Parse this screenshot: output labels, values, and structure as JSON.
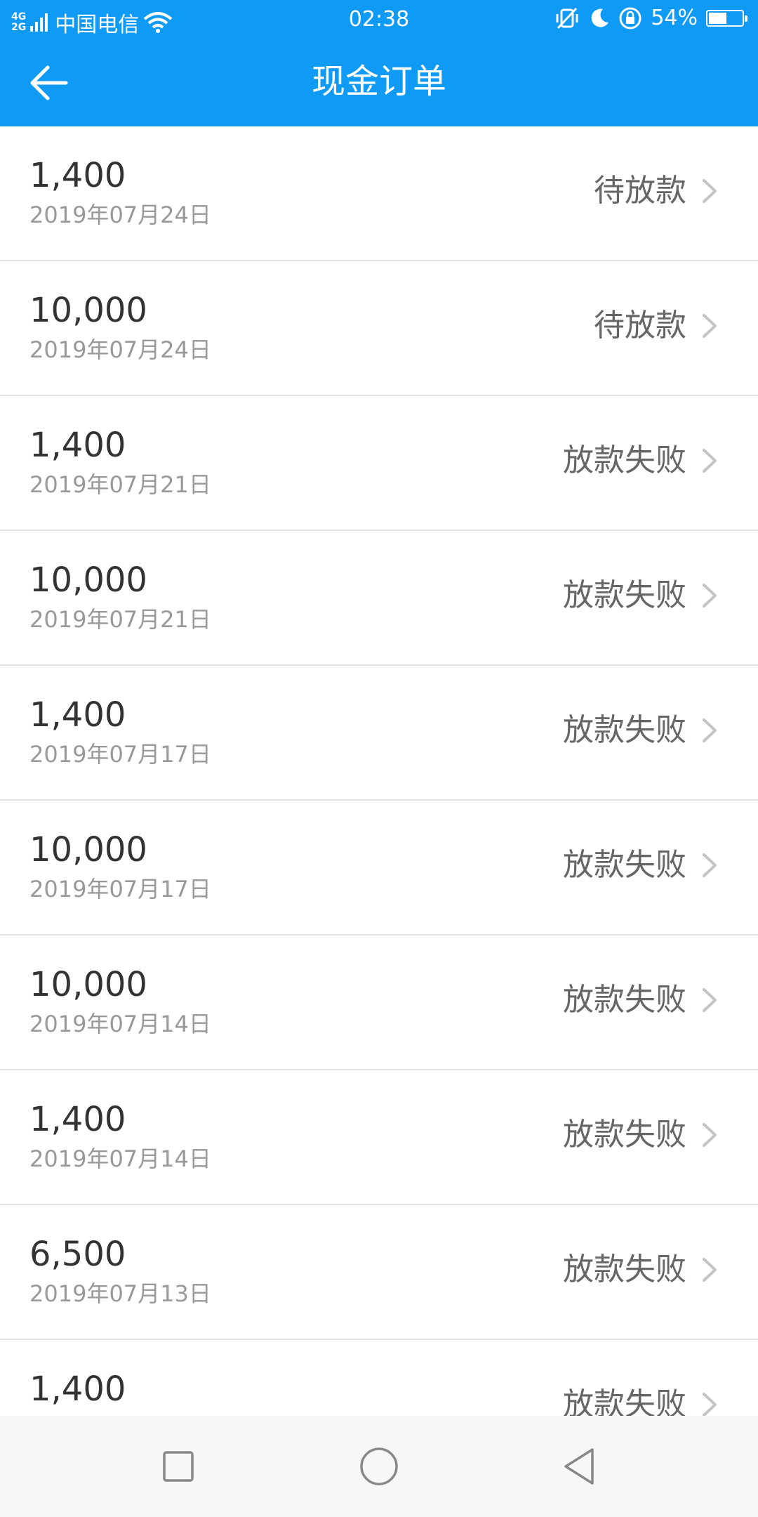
{
  "status_bar": {
    "network_top": "4G",
    "network_bottom": "2G",
    "carrier": "中国电信",
    "time": "02:38",
    "battery": "54%",
    "battery_level": 0.54
  },
  "header": {
    "title": "现金订单"
  },
  "orders": [
    {
      "amount": "1,400",
      "date": "2019年07月24日",
      "status": "待放款"
    },
    {
      "amount": "10,000",
      "date": "2019年07月24日",
      "status": "待放款"
    },
    {
      "amount": "1,400",
      "date": "2019年07月21日",
      "status": "放款失败"
    },
    {
      "amount": "10,000",
      "date": "2019年07月21日",
      "status": "放款失败"
    },
    {
      "amount": "1,400",
      "date": "2019年07月17日",
      "status": "放款失败"
    },
    {
      "amount": "10,000",
      "date": "2019年07月17日",
      "status": "放款失败"
    },
    {
      "amount": "10,000",
      "date": "2019年07月14日",
      "status": "放款失败"
    },
    {
      "amount": "1,400",
      "date": "2019年07月14日",
      "status": "放款失败"
    },
    {
      "amount": "6,500",
      "date": "2019年07月13日",
      "status": "放款失败"
    },
    {
      "amount": "1,400",
      "date": "",
      "status": "放款失败"
    }
  ],
  "colors": {
    "primary": "#0f9af5",
    "amount_text": "#333333",
    "date_text": "#999999",
    "status_text": "#666666"
  }
}
